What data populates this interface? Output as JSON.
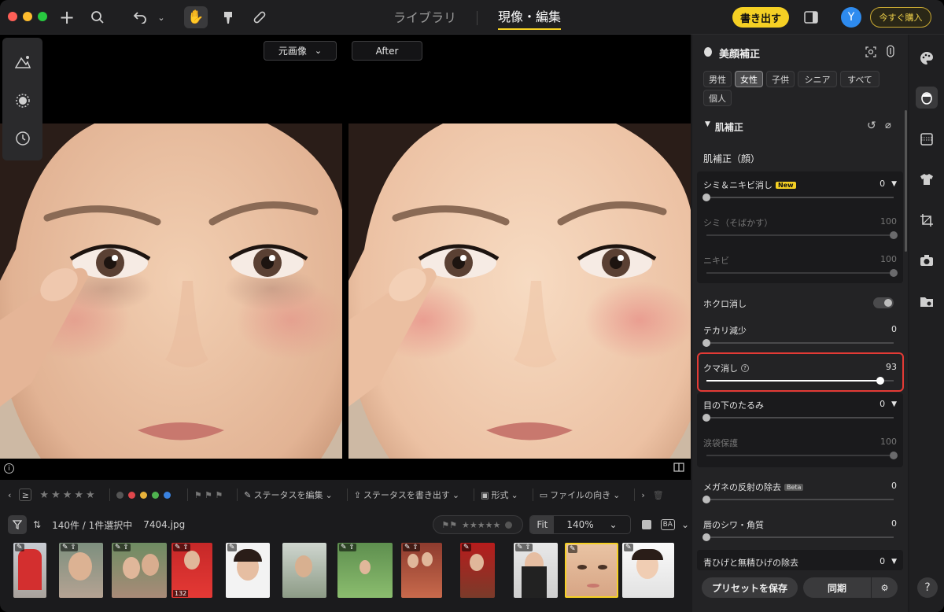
{
  "toolbar": {
    "tabs": [
      "ライブラリ",
      "現像・編集"
    ],
    "active_tab": "現像・編集",
    "export_label": "書き出す",
    "avatar_initial": "Y",
    "buy_label": "今すぐ購入",
    "icons": [
      "plus-icon",
      "search-icon",
      "undo-icon",
      "chevron-down-icon",
      "hand-icon",
      "brush-icon",
      "bandage-icon",
      "sidebar-toggle-icon"
    ]
  },
  "viewer": {
    "compare_left_label": "元画像",
    "compare_right_label": "After"
  },
  "filmstrip": {
    "menu": [
      "ステータスを編集",
      "ステータスを書き出す",
      "形式",
      "ファイルの向き"
    ],
    "count_text": "140件 / 1件選択中",
    "filename": "7404.jpg",
    "fit_label": "Fit",
    "zoom": "140%",
    "ba_label": "BA",
    "thumb_count": "132",
    "color_labels": [
      "#e0474c",
      "#e8b23a",
      "#4fb24f",
      "#3a82e0",
      "#8a8a8a"
    ]
  },
  "panel": {
    "title": "美顔補正",
    "chips": [
      "男性",
      "女性",
      "子供",
      "シニア",
      "すべて",
      "個人"
    ],
    "active_chip": "女性",
    "section": "肌補正",
    "subsection": "肌補正（顔）",
    "rows": {
      "spots": {
        "label": "シミ＆ニキビ消し",
        "badge": "New",
        "value": "0",
        "level": 0
      },
      "freckles": {
        "label": "シミ（そばかす）",
        "value": "100",
        "level": 1
      },
      "acne": {
        "label": "ニキビ",
        "value": "100",
        "level": 1
      },
      "mole": {
        "label": "ホクロ消し"
      },
      "shine": {
        "label": "テカリ減少",
        "value": "0",
        "level": 0
      },
      "dark": {
        "label": "クマ消し",
        "value": "93",
        "level": 0.93
      },
      "sag": {
        "label": "目の下のたるみ",
        "value": "0",
        "level": 0
      },
      "tear": {
        "label": "涙袋保護",
        "value": "100",
        "level": 1
      },
      "glasses": {
        "label": "メガネの反射の除去",
        "badge": "Beta",
        "value": "0",
        "level": 0
      },
      "lips": {
        "label": "唇のシワ・角質",
        "value": "0",
        "level": 0
      },
      "beard": {
        "label": "青ひげと無精ひげの除去",
        "value": "0"
      }
    },
    "save_preset": "プリセットを保存",
    "sync": "同期"
  },
  "help_label": "?"
}
